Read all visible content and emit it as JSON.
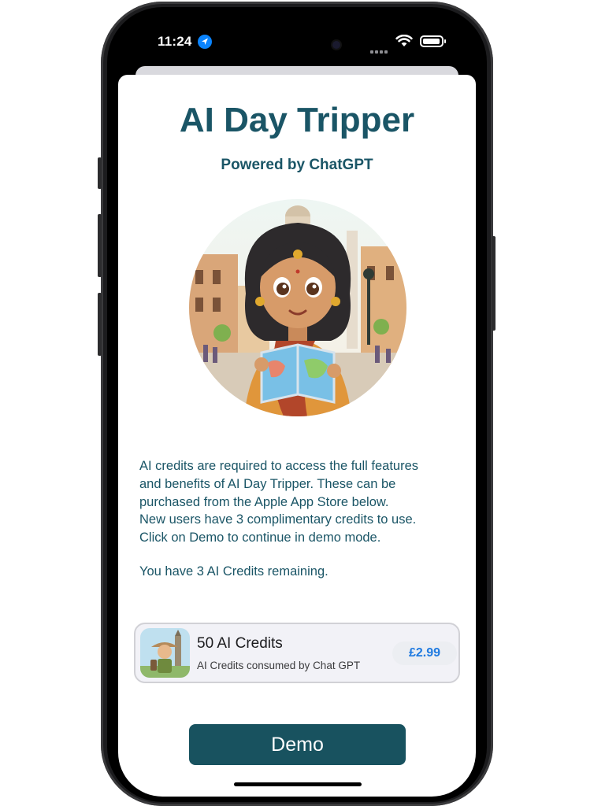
{
  "status_bar": {
    "time": "11:24",
    "location_icon": "location-arrow-icon",
    "wifi_icon": "wifi-icon",
    "battery_icon": "battery-icon",
    "signal_icon": "signal-icon"
  },
  "header": {
    "title": "AI Day Tripper",
    "subtitle": "Powered by ChatGPT"
  },
  "hero_image": {
    "icon": "traveller-illustration"
  },
  "info": {
    "lines": [
      "AI credits are required to access the full features",
      "and benefits of AI Day Tripper. These can be",
      "purchased from the Apple App Store below.",
      "New users have 3 complimentary credits to use.",
      "Click on Demo to continue in demo mode."
    ],
    "credits_remaining": "You have 3 AI Credits remaining."
  },
  "product": {
    "name": "50 AI Credits",
    "description": "AI Credits consumed by Chat GPT",
    "price": "£2.99",
    "thumbnail_icon": "explorer-thumbnail"
  },
  "demo_button": {
    "label": "Demo"
  },
  "colors": {
    "title": "#1a5566",
    "button": "#18525f",
    "price": "#1f7ae0",
    "card_background": "#f2f2f7"
  }
}
